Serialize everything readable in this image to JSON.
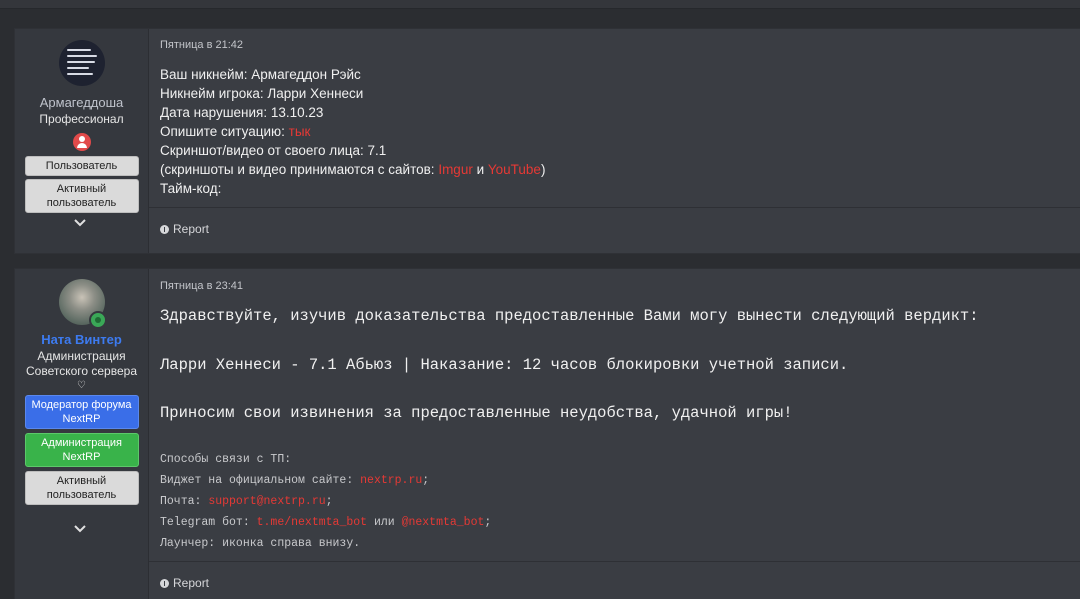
{
  "posts": [
    {
      "author": {
        "name": "Армагеддоша",
        "title": "Профессионал",
        "banners": [
          "Пользователь",
          "Активный пользователь"
        ]
      },
      "date": "Пятница в 21:42",
      "lines": [
        {
          "text": "Ваш никнейм: Армагеддон Рэйс"
        },
        {
          "text": "Никнейм игрока: Ларри Хеннеси"
        },
        {
          "text": "Дата нарушения: 13.10.23"
        },
        {
          "text": "Опишите ситуацию: ",
          "link": "тык"
        },
        {
          "text": "Скриншот/видео от своего лица: 7.1"
        },
        {
          "prefix": "(скриншоты и видео принимаются с сайтов: ",
          "link1": "Imgur",
          "mid": " и ",
          "link2": "YouTube",
          "suffix": ")"
        },
        {
          "text": "Тайм-код:"
        }
      ],
      "report_label": "Report"
    },
    {
      "author": {
        "name": "Ната Винтер",
        "title": "Администрация Советского сервера",
        "heart": "♡",
        "banners": [
          "Модератор форума NextRP",
          "Администрация NextRP",
          "Активный пользователь"
        ]
      },
      "date": "Пятница в 23:41",
      "big_lines": [
        "Здравствуйте, изучив доказательства предоставленные Вами могу вынести следующий вердикт:",
        "Ларри Хеннеси - 7.1 Абьюз | Наказание: 12 часов блокировки учетной записи.",
        "Приносим свои извинения за предоставленные неудобства, удачной игры!"
      ],
      "contacts": {
        "heading": "Способы связи с ТП:",
        "widget_label": "Виджет на официальном сайте: ",
        "widget_link": "nextrp.ru",
        "mail_label": "Почта: ",
        "mail_link": "support@nextrp.ru",
        "tg_label": "Telegram бот: ",
        "tg_link1": "t.me/nextmta_bot",
        "tg_or": " или ",
        "tg_link2": "@nextmta_bot",
        "launcher": "Лаунчер: иконка справа внизу.",
        "semicolon": ";"
      },
      "report_label": "Report"
    }
  ],
  "colors": {
    "link_red": "#e53935",
    "admin_name_blue": "#3d7bf0",
    "banner_blue": "#3a6ee8",
    "banner_green": "#39b34a"
  },
  "icons": [
    "chevron-down-icon",
    "report-icon",
    "user-badge-icon",
    "online-status-icon"
  ]
}
